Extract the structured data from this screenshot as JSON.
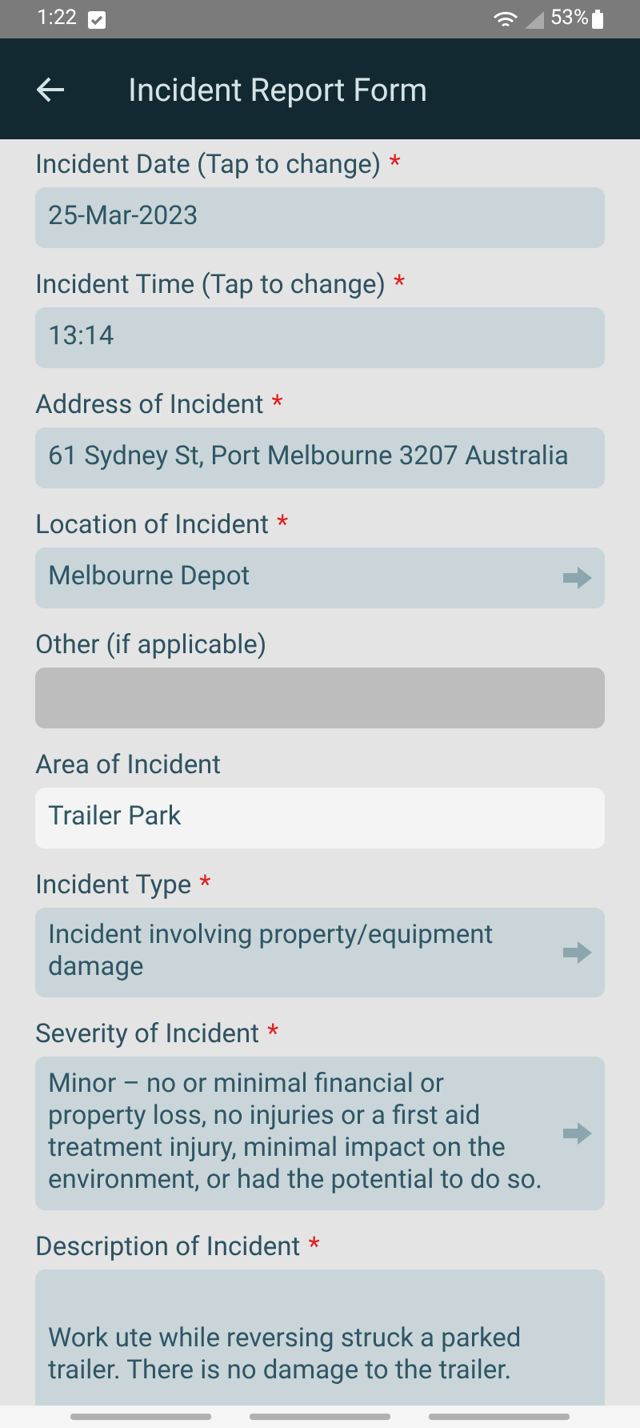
{
  "status_bar": {
    "time": "1:22",
    "battery": "53%"
  },
  "header": {
    "title": "Incident Report Form"
  },
  "fields": [
    {
      "label": "Incident Date (Tap to change)",
      "marker": "*",
      "kind": "locked",
      "value": "25-Mar-2023",
      "arrow": false
    },
    {
      "label": "Incident Time (Tap to change)",
      "marker": "*",
      "kind": "locked",
      "value": "13:14",
      "arrow": false
    },
    {
      "label": "Address of Incident",
      "marker": "*",
      "kind": "locked",
      "value": "61 Sydney St, Port Melbourne 3207 Australia",
      "arrow": false
    },
    {
      "label": "Location of Incident",
      "marker": "*",
      "kind": "locked",
      "value": "Melbourne Depot",
      "arrow": true
    },
    {
      "label": "Other (if applicable)",
      "kind": "disabled",
      "arrow": false
    },
    {
      "label": "Area of Incident",
      "kind": "editable",
      "value": "Trailer Park",
      "arrow": false
    },
    {
      "label": "Incident Type",
      "marker": "*",
      "kind": "locked",
      "value": "Incident involving property/equipment damage",
      "arrow": true
    },
    {
      "label": "Severity of Incident",
      "marker": "*",
      "kind": "locked",
      "value": "Minor – no or minimal financial or property loss, no injuries or a first aid treatment injury, minimal impact on the environment, or had the potential to do so.",
      "arrow": true
    },
    {
      "label": "Description of Incident",
      "marker": "*",
      "kind": "multiline",
      "value": "Work ute while reversing struck a parked trailer. There is no damage to the trailer.",
      "arrow": false
    }
  ]
}
